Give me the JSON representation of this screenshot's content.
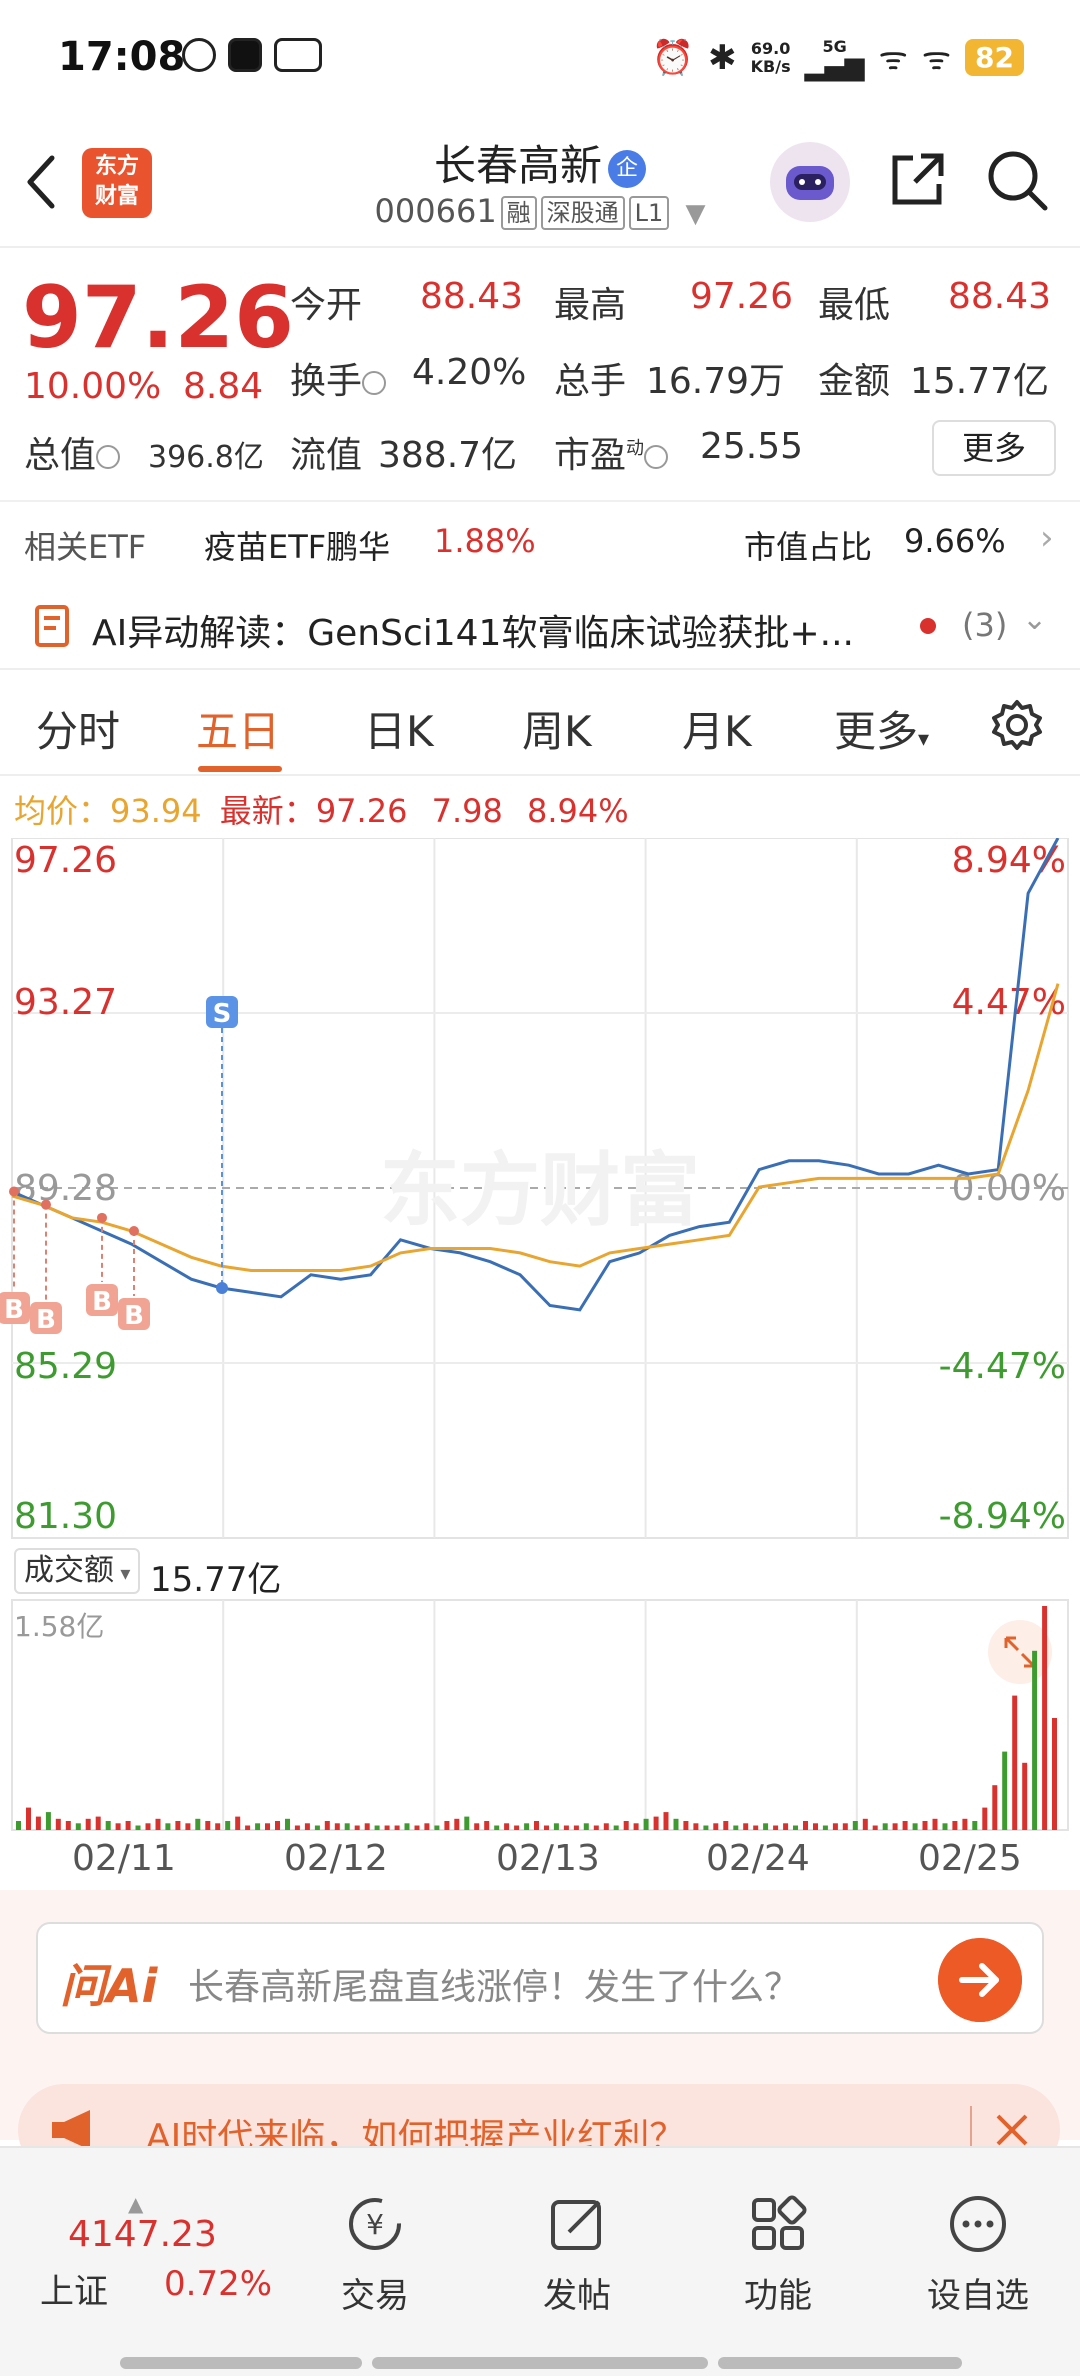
{
  "status": {
    "time": "17:08",
    "net_speed_value": "69.0",
    "net_speed_unit": "KB/s",
    "net_type": "5G",
    "battery": "82"
  },
  "header": {
    "stock_name": "长春高新",
    "badge": "企",
    "logo_line1": "东方",
    "logo_line2": "财富",
    "code": "000661",
    "tags": [
      "融",
      "深股通",
      "L1"
    ]
  },
  "quote": {
    "price": "97.26",
    "change_pct": "10.00%",
    "change": "8.84",
    "open_label": "今开",
    "open": "88.43",
    "high_label": "最高",
    "high": "97.26",
    "low_label": "最低",
    "low": "88.43",
    "turnover_label": "换手",
    "turnover": "4.20%",
    "volume_label": "总手",
    "volume": "16.79万",
    "amount_label": "金额",
    "amount": "15.77亿",
    "mcap_label": "总值",
    "mcap": "396.8亿",
    "float_label": "流值",
    "float": "388.7亿",
    "pe_label": "市盈",
    "pe_sup": "动",
    "pe": "25.55",
    "more": "更多"
  },
  "etf": {
    "label": "相关ETF",
    "name": "疫苗ETF鹏华",
    "pct": "1.88%",
    "ratio_label": "市值占比",
    "ratio": "9.66%"
  },
  "ai_news": {
    "text": "AI异动解读：GenSci141软膏临床试验获批+...",
    "count": "(3)"
  },
  "tabs": [
    "分时",
    "五日",
    "日K",
    "周K",
    "月K",
    "更多"
  ],
  "active_tab": 1,
  "avg_row": {
    "avg_label": "均价：",
    "avg": "93.94",
    "latest_label": "最新：",
    "latest": "97.26",
    "change": "7.98",
    "pct": "8.94%"
  },
  "chart_data": {
    "type": "line",
    "title": "",
    "y_labels_left": [
      "97.26",
      "93.27",
      "89.28",
      "85.29",
      "81.30"
    ],
    "y_labels_right": [
      "8.94%",
      "4.47%",
      "0.00%",
      "-4.47%",
      "-8.94%"
    ],
    "ylim": [
      81.3,
      97.26
    ],
    "prev_close": 89.28,
    "dates": [
      "02/11",
      "02/12",
      "02/13",
      "02/24",
      "02/25"
    ],
    "series": [
      {
        "name": "price",
        "color": "#3a6fb5",
        "values": [
          89.2,
          88.9,
          88.6,
          88.3,
          88.0,
          87.6,
          87.2,
          87.0,
          86.9,
          86.8,
          87.3,
          87.2,
          87.3,
          88.1,
          87.9,
          87.8,
          87.6,
          87.3,
          86.6,
          86.5,
          87.6,
          87.8,
          88.2,
          88.4,
          88.5,
          89.7,
          89.9,
          89.9,
          89.8,
          89.6,
          89.6,
          89.8,
          89.6,
          89.7,
          96.0,
          97.26
        ]
      },
      {
        "name": "avg",
        "color": "#e8a530",
        "values": [
          89.1,
          88.9,
          88.6,
          88.5,
          88.3,
          88.0,
          87.7,
          87.5,
          87.4,
          87.4,
          87.4,
          87.4,
          87.5,
          87.8,
          87.9,
          87.9,
          87.9,
          87.8,
          87.6,
          87.5,
          87.8,
          87.9,
          88.0,
          88.1,
          88.2,
          89.3,
          89.4,
          89.5,
          89.5,
          89.5,
          89.5,
          89.5,
          89.5,
          89.6,
          91.5,
          93.94
        ]
      }
    ],
    "markers": {
      "buy_label": "B",
      "sell_label": "S",
      "buy_count": 4
    },
    "volume": {
      "label": "成交额",
      "total": "15.77亿",
      "max_label": "1.58亿",
      "bars": [
        0.04,
        0.1,
        0.06,
        0.08,
        0.05,
        0.04,
        0.03,
        0.05,
        0.06,
        0.04,
        0.03,
        0.04,
        0.02,
        0.03,
        0.05,
        0.03,
        0.04,
        0.03,
        0.05,
        0.04,
        0.03,
        0.04,
        0.06,
        0.02,
        0.03,
        0.03,
        0.04,
        0.05,
        0.02,
        0.03,
        0.02,
        0.04,
        0.03,
        0.03,
        0.02,
        0.03,
        0.02,
        0.02,
        0.02,
        0.03,
        0.02,
        0.03,
        0.02,
        0.04,
        0.05,
        0.06,
        0.03,
        0.04,
        0.02,
        0.03,
        0.02,
        0.03,
        0.04,
        0.02,
        0.03,
        0.02,
        0.02,
        0.03,
        0.02,
        0.03,
        0.02,
        0.04,
        0.03,
        0.05,
        0.06,
        0.08,
        0.05,
        0.04,
        0.03,
        0.02,
        0.03,
        0.04,
        0.02,
        0.03,
        0.02,
        0.03,
        0.02,
        0.03,
        0.02,
        0.04,
        0.03,
        0.02,
        0.03,
        0.03,
        0.04,
        0.05,
        0.02,
        0.03,
        0.03,
        0.04,
        0.03,
        0.04,
        0.05,
        0.03,
        0.04,
        0.05,
        0.04,
        0.1,
        0.2,
        0.35,
        0.6,
        0.3,
        0.8,
        1.0,
        0.5
      ]
    }
  },
  "ask_ai": {
    "logo": "问Ai",
    "text": "长春高新尾盘直线涨停！发生了什么？"
  },
  "promo": {
    "text": "AI时代来临，如何把握产业红利？"
  },
  "bottom_nav": {
    "index_value": "4147.23",
    "index_name": "上证",
    "index_pct": "0.72%",
    "items": [
      "交易",
      "发帖",
      "功能",
      "设自选"
    ]
  },
  "colors": {
    "up": "#d9312e",
    "down": "#3e9b2f",
    "accent": "#e2622b"
  }
}
